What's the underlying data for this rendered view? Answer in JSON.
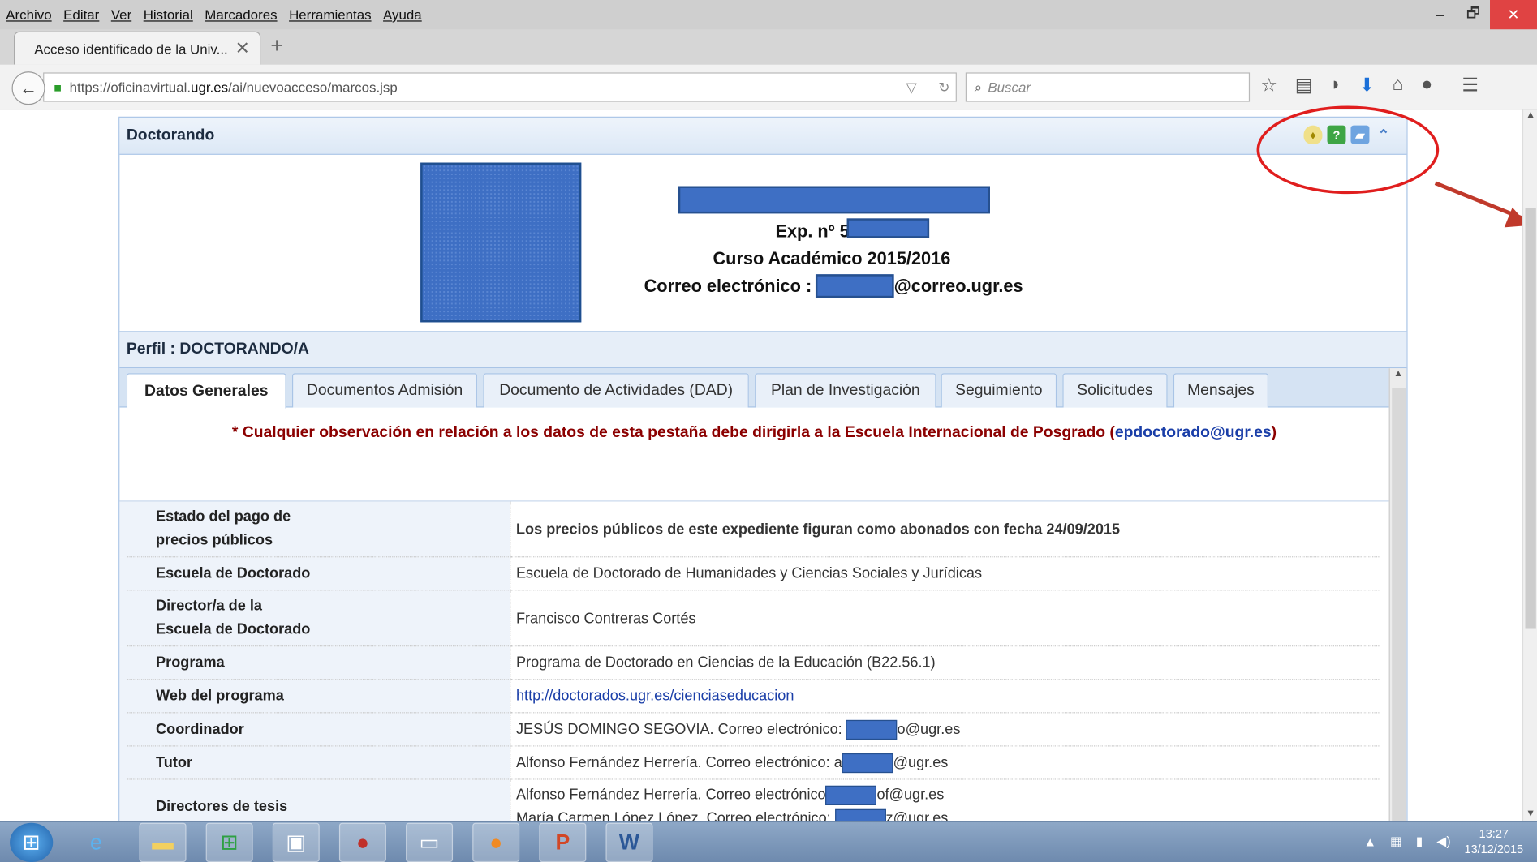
{
  "menubar": {
    "items": [
      "Archivo",
      "Editar",
      "Ver",
      "Historial",
      "Marcadores",
      "Herramientas",
      "Ayuda"
    ]
  },
  "window_controls": {
    "minimize": "–",
    "restore": "🗗",
    "close": "✕"
  },
  "tab": {
    "title": "Acceso identificado de la Univ...",
    "close": "✕",
    "new": "+"
  },
  "navbar": {
    "url_prefix": "https://oficinavirtual.",
    "url_domain": "ugr.es",
    "url_path": "/ai/nuevoacceso/marcos.jsp",
    "search_placeholder": "Buscar"
  },
  "panel": {
    "title": "Doctorando",
    "exp_label": "Exp. nº 5",
    "course": "Curso Académico 2015/2016",
    "email_label": "Correo electrónico :",
    "email_domain": "@correo.ugr.es",
    "profile": "Perfil : DOCTORANDO/A"
  },
  "tabs": [
    "Datos Generales",
    "Documentos Admisión",
    "Documento de Actividades (DAD)",
    "Plan de Investigación",
    "Seguimiento",
    "Solicitudes",
    "Mensajes"
  ],
  "notice": {
    "text": "* Cualquier observación en relación a los datos de esta pestaña debe dirigirla a la Escuela Internacional de Posgrado (",
    "email": "epdoctorado@ugr.es",
    "close": ")"
  },
  "rows": [
    {
      "k1": "Estado del pago de",
      "k2": "precios públicos",
      "v": "Los precios públicos de este expediente figuran como abonados con fecha 24/09/2015"
    },
    {
      "k1": "Escuela de Doctorado",
      "v": "Escuela de Doctorado de Humanidades y Ciencias Sociales y Jurídicas"
    },
    {
      "k1": "Director/a de la",
      "k2": "Escuela de Doctorado",
      "v": "Francisco Contreras Cortés"
    },
    {
      "k1": "Programa",
      "v": "Programa de Doctorado en Ciencias de la Educación (B22.56.1)"
    },
    {
      "k1": "Web del programa",
      "v": "http://doctorados.ugr.es/cienciaseducacion"
    },
    {
      "k1": "Coordinador",
      "v": "JESÚS DOMINGO SEGOVIA. Correo electrónico:",
      "v_suffix": "o@ugr.es"
    },
    {
      "k1": "Tutor",
      "v": "Alfonso Fernández Herrería. Correo electrónico: a",
      "v_suffix": "@ugr.es"
    },
    {
      "k1": "Directores de tesis",
      "v": "Alfonso Fernández Herrería. Correo electrónico",
      "v_suffix": "of@ugr.es",
      "v2": "María Carmen López López. Correo electrónico:",
      "v2_suffix": "z@ugr.es"
    }
  ],
  "taskbar": {
    "time": "13:27",
    "date": "13/12/2015"
  }
}
